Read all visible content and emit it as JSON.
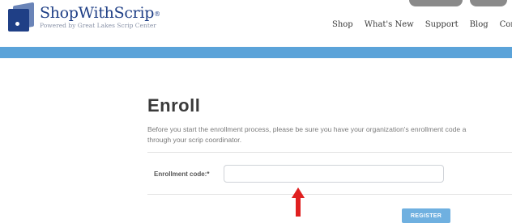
{
  "header": {
    "logo": {
      "name": "ShopWithScrip",
      "trademark": "®",
      "tagline": "Powered by Great Lakes Scrip Center",
      "icon": "scrip-card-logo-icon"
    },
    "nav": [
      {
        "label": "Shop"
      },
      {
        "label": "What's New"
      },
      {
        "label": "Support"
      },
      {
        "label": "Blog"
      },
      {
        "label": "Cont"
      }
    ]
  },
  "colors": {
    "brand_blue": "#1f3f86",
    "accent_bar": "#5ba3d9",
    "button": "#6fb0e0",
    "annotation": "#e02020"
  },
  "enroll": {
    "title": "Enroll",
    "instructions_line1": "Before you start the enrollment process, please be sure you have your organization's enrollment code a",
    "instructions_line2": "through your scrip coordinator.",
    "enrollment_code_label": "Enrollment code:*",
    "enrollment_code_value": "",
    "enrollment_code_placeholder": "",
    "register_label": "REGISTER"
  },
  "annotation": {
    "icon": "red-up-arrow-icon"
  }
}
